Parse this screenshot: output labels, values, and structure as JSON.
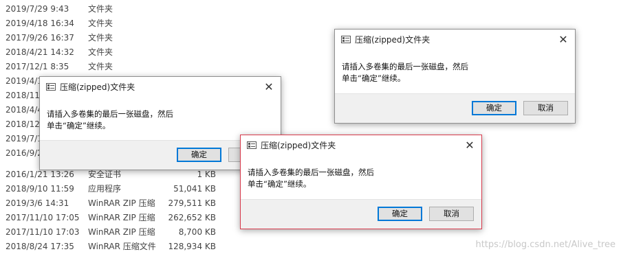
{
  "file_list": {
    "rows": [
      {
        "date": "2019/7/29 9:43",
        "type": "文件夹",
        "size": ""
      },
      {
        "date": "2019/4/18 16:34",
        "type": "文件夹",
        "size": ""
      },
      {
        "date": "2017/9/26 16:37",
        "type": "文件夹",
        "size": ""
      },
      {
        "date": "2018/4/21 14:32",
        "type": "文件夹",
        "size": ""
      },
      {
        "date": "2017/12/1 8:35",
        "type": "文件夹",
        "size": ""
      },
      {
        "date": "2019/4/1",
        "type": "",
        "size": ""
      },
      {
        "date": "2018/11/",
        "type": "",
        "size": ""
      },
      {
        "date": "2018/4/4",
        "type": "",
        "size": ""
      },
      {
        "date": "2018/12/",
        "type": "",
        "size": ""
      },
      {
        "date": "2019/7/1",
        "type": "",
        "size": ""
      },
      {
        "date": "2016/9/2",
        "type": "",
        "size": ""
      },
      {
        "date": "2016/1/21 13:26",
        "type": "安全证书",
        "size": "1 KB"
      },
      {
        "date": "2018/9/10 11:59",
        "type": "应用程序",
        "size": "51,041 KB"
      },
      {
        "date": "2019/3/6 14:31",
        "type": "WinRAR ZIP 压缩",
        "size": "279,511 KB"
      },
      {
        "date": "2017/11/10 17:05",
        "type": "WinRAR ZIP 压缩",
        "size": "262,652 KB"
      },
      {
        "date": "2017/11/10 17:03",
        "type": "WinRAR ZIP 压缩",
        "size": "8,700 KB"
      },
      {
        "date": "2018/8/24 17:35",
        "type": "WinRAR 压缩文件",
        "size": "128,934 KB"
      }
    ]
  },
  "dialogs": [
    {
      "title": "压缩(zipped)文件夹",
      "message_line1": "请插入多卷集的最后一张磁盘，然后",
      "message_line2": "单击“确定”继续。",
      "ok_label": "确定",
      "cancel_label": "",
      "close_icon": "close-icon"
    },
    {
      "title": "压缩(zipped)文件夹",
      "message_line1": "请插入多卷集的最后一张磁盘，然后",
      "message_line2": "单击“确定”继续。",
      "ok_label": "确定",
      "cancel_label": "取消",
      "close_icon": "close-icon"
    },
    {
      "title": "压缩(zipped)文件夹",
      "message_line1": "请插入多卷集的最后一张磁盘，然后",
      "message_line2": "单击“确定”继续。",
      "ok_label": "确定",
      "cancel_label": "取消",
      "close_icon": "close-icon"
    }
  ],
  "watermark": "https://blog.csdn.net/Alive_tree",
  "colors": {
    "active_border": "#d8394b",
    "default_button_border": "#0078d7"
  }
}
